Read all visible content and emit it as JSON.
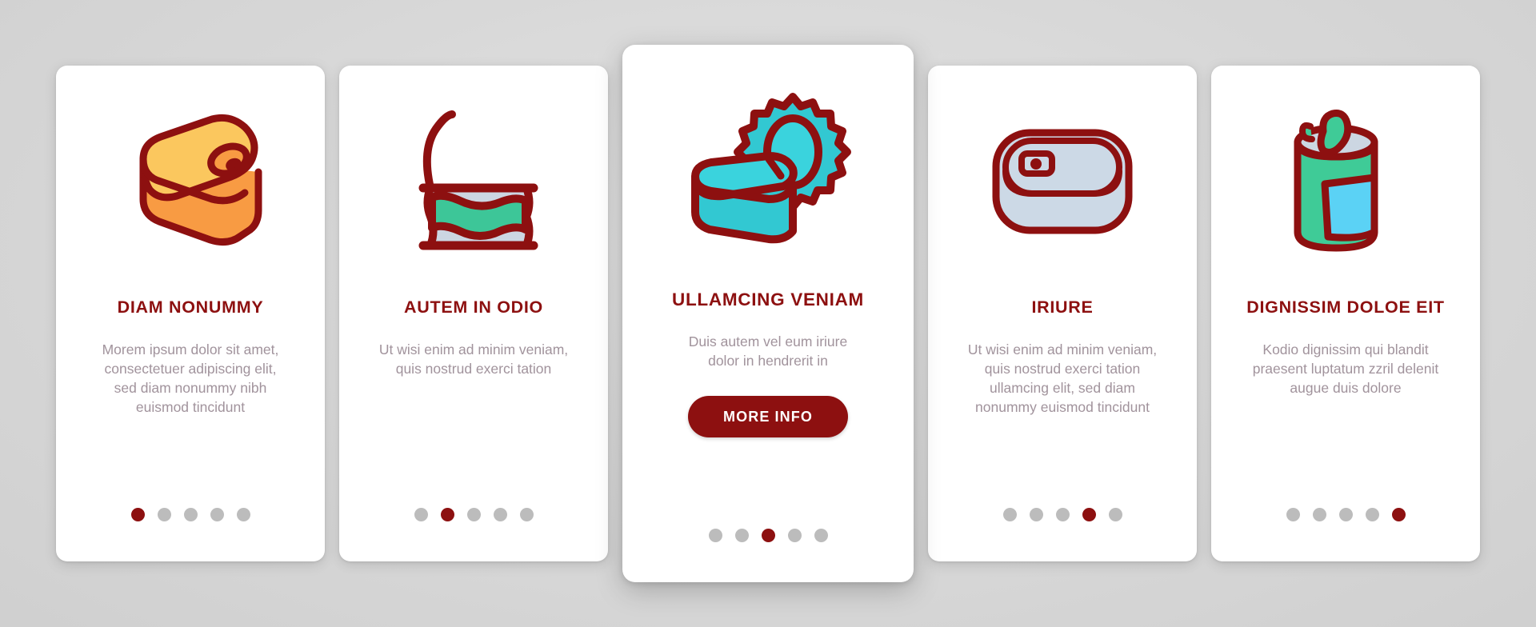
{
  "background": {
    "color": "#d9d9d9"
  },
  "theme": {
    "accent": "#8d1010",
    "card_bg": "#ffffff",
    "title_color": "#8d1010",
    "body_color": "#a1939c",
    "dot_inactive": "#bcbcbc",
    "dot_active": "#8d1010"
  },
  "cards": [
    {
      "icon_name": "oval-tin-can-icon",
      "title": "DIAM NONUMMY",
      "body": "Morem ipsum dolor sit amet, consectetuer adipiscing elit, sed diam nonummy nibh euismod tincidunt",
      "dots": {
        "count": 5,
        "active_index": 0
      },
      "featured": false,
      "button": null
    },
    {
      "icon_name": "sealed-food-pouch-icon",
      "title": "AUTEM IN ODIO",
      "body": "Ut wisi enim ad minim veniam, quis nostrud exerci tation",
      "dots": {
        "count": 5,
        "active_index": 1
      },
      "featured": false,
      "button": null
    },
    {
      "icon_name": "open-tin-can-with-lid-icon",
      "title": "ULLAMCING VENIAM",
      "body": "Duis autem vel eum iriure dolor in hendrerit in",
      "dots": {
        "count": 5,
        "active_index": 2
      },
      "featured": true,
      "button": {
        "label": "MORE INFO"
      }
    },
    {
      "icon_name": "sardine-tin-top-view-icon",
      "title": "IRIURE",
      "body": "Ut wisi enim ad minim veniam, quis nostrud exerci tation ullamcing elit, sed diam nonummy euismod tincidunt",
      "dots": {
        "count": 5,
        "active_index": 3
      },
      "featured": false,
      "button": null
    },
    {
      "icon_name": "opened-beverage-can-icon",
      "title": "DIGNISSIM DOLOE EIT",
      "body": "Kodio dignissim qui blandit praesent luptatum zzril delenit augue duis dolore",
      "dots": {
        "count": 5,
        "active_index": 4
      },
      "featured": false,
      "button": null
    }
  ]
}
